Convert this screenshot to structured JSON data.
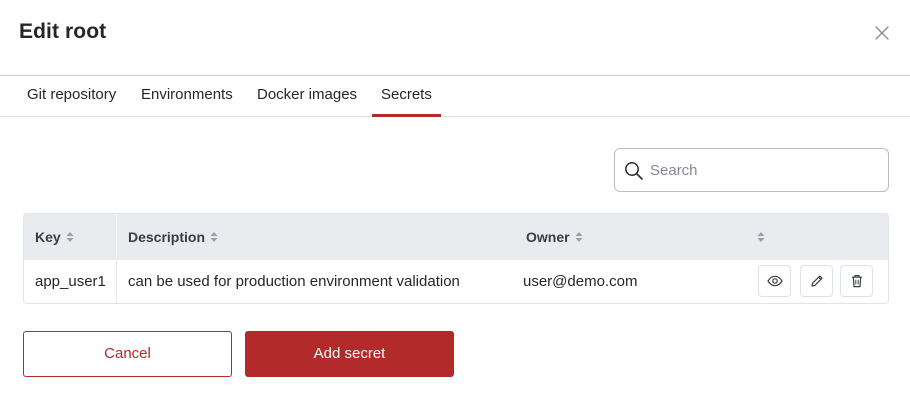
{
  "dialog": {
    "title": "Edit root",
    "close_icon": "close-icon"
  },
  "tabs": [
    {
      "label": "Git repository",
      "active": false
    },
    {
      "label": "Environments",
      "active": false
    },
    {
      "label": "Docker images",
      "active": false
    },
    {
      "label": "Secrets",
      "active": true
    }
  ],
  "search": {
    "placeholder": "Search",
    "value": "",
    "icon": "search-icon"
  },
  "table": {
    "columns": [
      {
        "label": "Key",
        "sortable": true
      },
      {
        "label": "Description",
        "sortable": true
      },
      {
        "label": "Owner",
        "sortable": true
      },
      {
        "label": "",
        "sortable": true
      }
    ],
    "rows": [
      {
        "key": "app_user1",
        "description": "can be used for production environment validation",
        "owner": "user@demo.com",
        "actions": [
          "eye-icon",
          "pencil-icon",
          "trash-icon"
        ]
      }
    ]
  },
  "footer": {
    "cancel_label": "Cancel",
    "add_label": "Add secret"
  },
  "colors": {
    "accent": "#b22a29",
    "header_bg": "#e9ebef",
    "border": "#b9bec5"
  }
}
